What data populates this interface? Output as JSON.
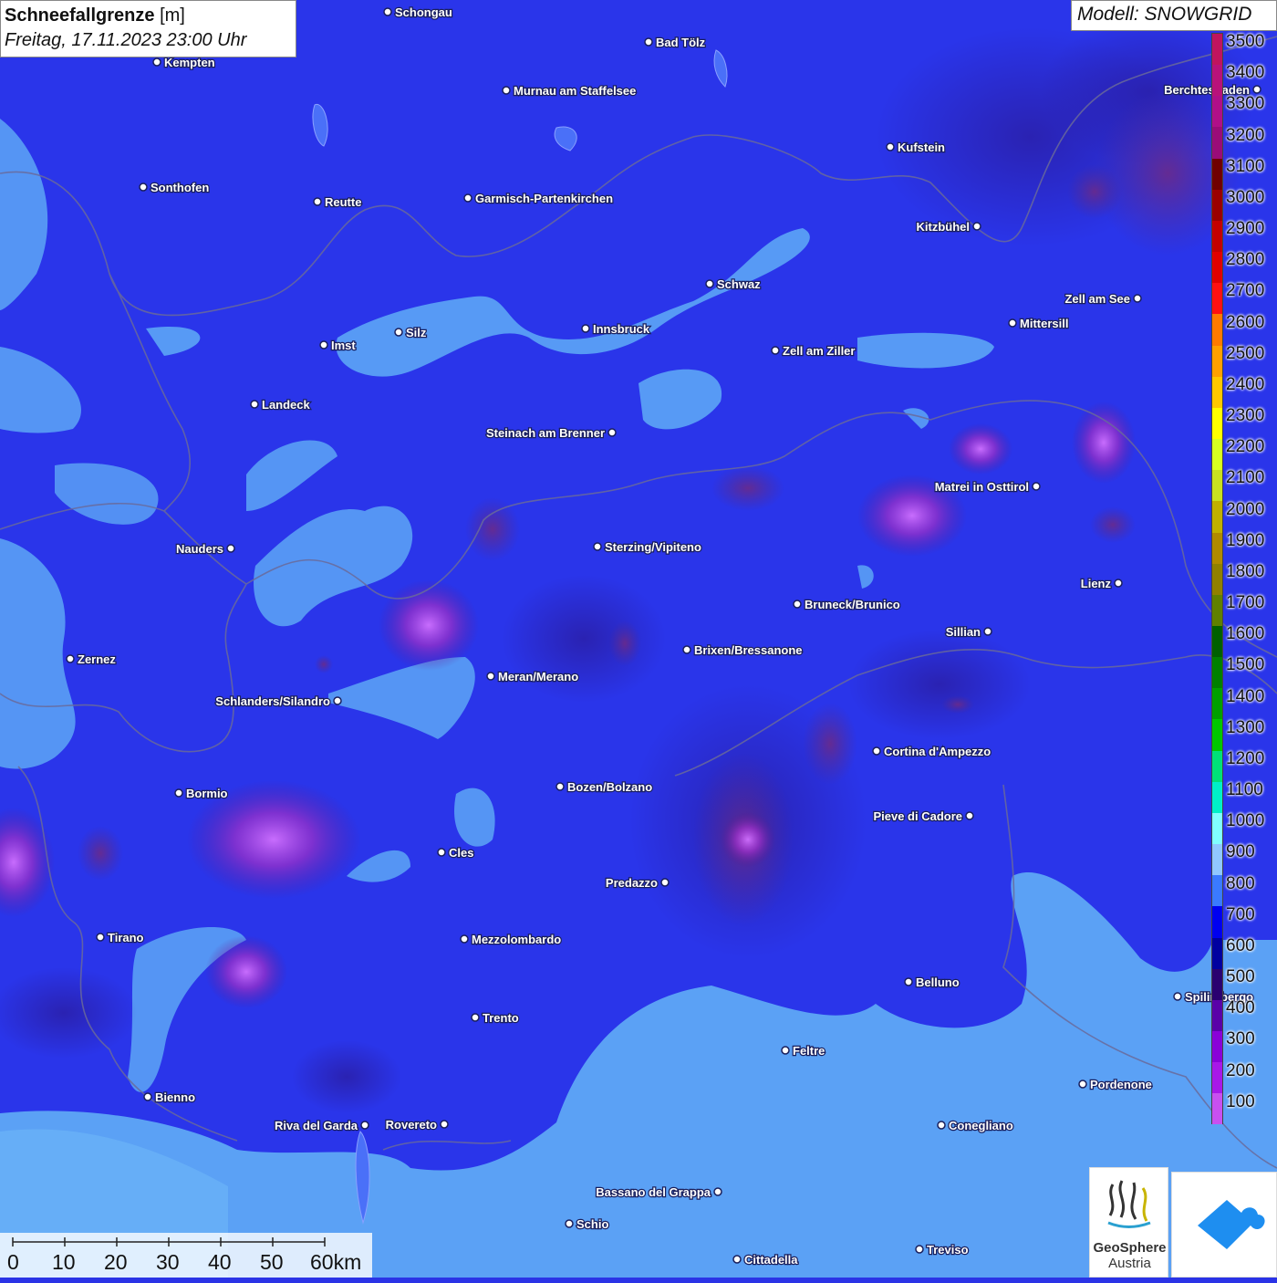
{
  "header": {
    "title": "Schneefallgrenze",
    "unit": "[m]",
    "datetime": "Freitag, 17.11.2023 23:00 Uhr"
  },
  "model": {
    "label": "Modell: SNOWGRID"
  },
  "legend": {
    "values": [
      "3500",
      "3400",
      "3300",
      "3200",
      "3100",
      "3000",
      "2900",
      "2800",
      "2700",
      "2600",
      "2500",
      "2400",
      "2300",
      "2200",
      "2100",
      "2000",
      "1900",
      "1800",
      "1700",
      "1600",
      "1500",
      "1400",
      "1300",
      "1200",
      "1100",
      "1000",
      "900",
      "800",
      "700",
      "600",
      "500",
      "400",
      "300",
      "200",
      "100"
    ],
    "colors": [
      "#c0145e",
      "#b8127a",
      "#b00f88",
      "#9a0c78",
      "#700000",
      "#9a0000",
      "#c40000",
      "#e00000",
      "#ff1010",
      "#ff7a00",
      "#ffa000",
      "#ffc800",
      "#ffff00",
      "#d8ff20",
      "#c8e020",
      "#c0b000",
      "#b08a00",
      "#908000",
      "#608000",
      "#006000",
      "#008000",
      "#00a000",
      "#00c800",
      "#00e078",
      "#00f0c8",
      "#80ffff",
      "#90c8ff",
      "#3a7aff",
      "#0000f0",
      "#0000a0",
      "#2a0070",
      "#5a00a8",
      "#8a00d8",
      "#a818e8",
      "#c850f0"
    ]
  },
  "scale": {
    "labels": [
      "0",
      "10",
      "20",
      "30",
      "40",
      "50",
      "60km"
    ]
  },
  "cities": [
    {
      "name": "Schongau",
      "side": "r"
    },
    {
      "name": "Bad Tölz",
      "side": "r"
    },
    {
      "name": "Kempten",
      "side": "r"
    },
    {
      "name": "Murnau am Staffelsee",
      "side": "r"
    },
    {
      "name": "Berchtesgaden",
      "side": "l"
    },
    {
      "name": "Kufstein",
      "side": "r"
    },
    {
      "name": "Sonthofen",
      "side": "r"
    },
    {
      "name": "Reutte",
      "side": "r"
    },
    {
      "name": "Garmisch-Partenkirchen",
      "side": "r"
    },
    {
      "name": "Kitzbühel",
      "side": "l"
    },
    {
      "name": "Schwaz",
      "side": "r"
    },
    {
      "name": "Zell am See",
      "side": "l"
    },
    {
      "name": "Mittersill",
      "side": "r"
    },
    {
      "name": "Innsbruck",
      "side": "r"
    },
    {
      "name": "Imst",
      "side": "r"
    },
    {
      "name": "Silz",
      "side": "r"
    },
    {
      "name": "Zell am Ziller",
      "side": "r"
    },
    {
      "name": "Landeck",
      "side": "r"
    },
    {
      "name": "Steinach am Brenner",
      "side": "l"
    },
    {
      "name": "Matrei in Osttirol",
      "side": "l"
    },
    {
      "name": "Nauders",
      "side": "l"
    },
    {
      "name": "Sterzing/Vipiteno",
      "side": "r"
    },
    {
      "name": "Lienz",
      "side": "l"
    },
    {
      "name": "Bruneck/Brunico",
      "side": "r"
    },
    {
      "name": "Sillian",
      "side": "l"
    },
    {
      "name": "Zernez",
      "side": "r"
    },
    {
      "name": "Brixen/Bressanone",
      "side": "r"
    },
    {
      "name": "Meran/Merano",
      "side": "r"
    },
    {
      "name": "Schlanders/Silandro",
      "side": "l"
    },
    {
      "name": "Cortina d'Ampezzo",
      "side": "r"
    },
    {
      "name": "Bozen/Bolzano",
      "side": "r"
    },
    {
      "name": "Bormio",
      "side": "r"
    },
    {
      "name": "Pieve di Cadore",
      "side": "l"
    },
    {
      "name": "Cles",
      "side": "r"
    },
    {
      "name": "Predazzo",
      "side": "l"
    },
    {
      "name": "Tirano",
      "side": "r"
    },
    {
      "name": "Mezzolombardo",
      "side": "r"
    },
    {
      "name": "Belluno",
      "side": "r"
    },
    {
      "name": "Spilimbergo",
      "side": "r"
    },
    {
      "name": "Trento",
      "side": "r"
    },
    {
      "name": "Feltre",
      "side": "r"
    },
    {
      "name": "Pordenone",
      "side": "r"
    },
    {
      "name": "Bienno",
      "side": "r"
    },
    {
      "name": "Riva del Garda",
      "side": "l"
    },
    {
      "name": "Rovereto",
      "side": "l"
    },
    {
      "name": "Conegliano",
      "side": "r"
    },
    {
      "name": "Bassano del Grappa",
      "side": "l"
    },
    {
      "name": "Schio",
      "side": "r"
    },
    {
      "name": "Treviso",
      "side": "r"
    },
    {
      "name": "Cittadella",
      "side": "r"
    }
  ],
  "logos": {
    "geosphere_name": "GeoSphere",
    "geosphere_sub": "Austria"
  }
}
